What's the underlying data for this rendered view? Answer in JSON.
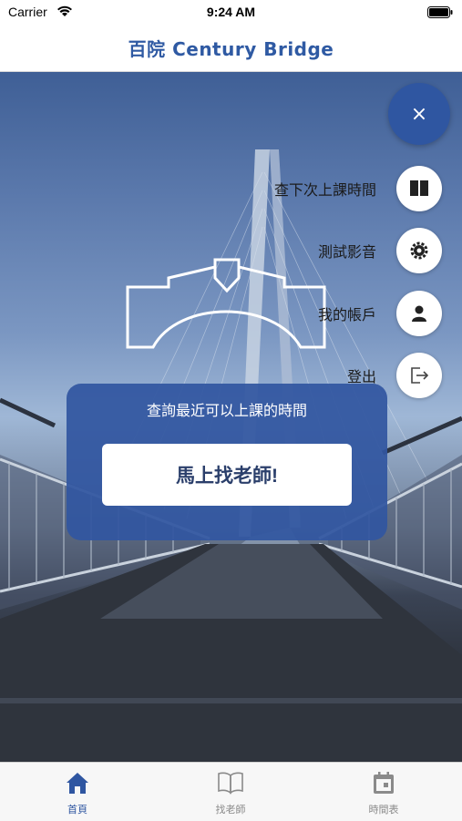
{
  "status_bar": {
    "carrier": "Carrier",
    "time": "9:24 AM"
  },
  "nav": {
    "title": "百院 Century Bridge"
  },
  "fab": {
    "close_glyph": "×"
  },
  "menu": {
    "items": [
      {
        "label": "查下次上課時間",
        "icon": "book-icon"
      },
      {
        "label": "測試影音",
        "icon": "gear-icon"
      },
      {
        "label": "我的帳戶",
        "icon": "person-icon"
      },
      {
        "label": "登出",
        "icon": "logout-icon"
      }
    ]
  },
  "card": {
    "subtitle": "查詢最近可以上課的時間",
    "cta_label": "馬上找老師!"
  },
  "tabs": [
    {
      "label": "首頁",
      "icon": "home-icon",
      "active": true
    },
    {
      "label": "找老師",
      "icon": "book-open-icon",
      "active": false
    },
    {
      "label": "時間表",
      "icon": "calendar-icon",
      "active": false
    }
  ],
  "colors": {
    "brand": "#2f56a1",
    "tab_inactive": "#8a8a8a"
  }
}
